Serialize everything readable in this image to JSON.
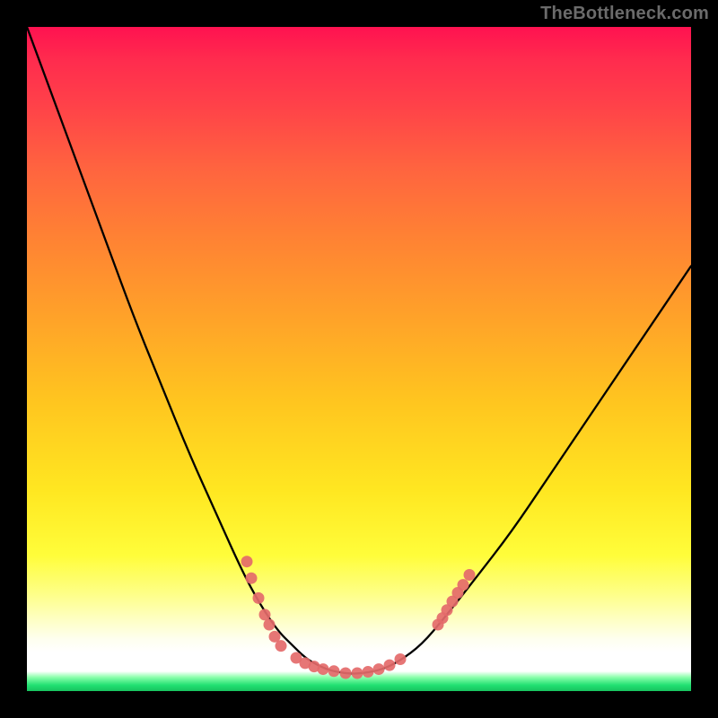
{
  "attribution": "TheBottleneck.com",
  "chart_data": {
    "type": "line",
    "title": "",
    "xlabel": "",
    "ylabel": "",
    "xlim": [
      0,
      740
    ],
    "ylim_percent": [
      0,
      100
    ],
    "series": [
      {
        "name": "bottleneck-curve",
        "x": [
          0,
          30,
          60,
          90,
          120,
          150,
          180,
          210,
          240,
          260,
          280,
          295,
          310,
          325,
          340,
          360,
          375,
          395,
          415,
          440,
          465,
          500,
          540,
          580,
          620,
          660,
          700,
          720,
          740
        ],
        "y": [
          100,
          89,
          78,
          67,
          56,
          46,
          36,
          27,
          18,
          13,
          9,
          7,
          5,
          3.8,
          3,
          2.6,
          2.7,
          3.2,
          4.5,
          7,
          11,
          17,
          24,
          32,
          40,
          48,
          56,
          60,
          64
        ]
      }
    ],
    "markers": [
      {
        "name": "cluster-left",
        "points": [
          {
            "x": 245,
            "y": 19.5
          },
          {
            "x": 250,
            "y": 17
          },
          {
            "x": 258,
            "y": 14
          },
          {
            "x": 265,
            "y": 11.5
          },
          {
            "x": 270,
            "y": 10
          },
          {
            "x": 276,
            "y": 8.2
          },
          {
            "x": 283,
            "y": 6.8
          }
        ]
      },
      {
        "name": "cluster-bottom",
        "points": [
          {
            "x": 300,
            "y": 5
          },
          {
            "x": 310,
            "y": 4.2
          },
          {
            "x": 320,
            "y": 3.7
          },
          {
            "x": 330,
            "y": 3.3
          },
          {
            "x": 342,
            "y": 3
          },
          {
            "x": 355,
            "y": 2.7
          },
          {
            "x": 368,
            "y": 2.7
          },
          {
            "x": 380,
            "y": 2.9
          },
          {
            "x": 392,
            "y": 3.3
          },
          {
            "x": 404,
            "y": 3.9
          },
          {
            "x": 416,
            "y": 4.8
          }
        ]
      },
      {
        "name": "cluster-right",
        "points": [
          {
            "x": 458,
            "y": 10
          },
          {
            "x": 463,
            "y": 11
          },
          {
            "x": 468,
            "y": 12.2
          },
          {
            "x": 474,
            "y": 13.5
          },
          {
            "x": 480,
            "y": 14.8
          },
          {
            "x": 486,
            "y": 16
          },
          {
            "x": 493,
            "y": 17.5
          }
        ]
      }
    ],
    "gradient_stops": [
      {
        "pos": 0,
        "color": "#ff1250"
      },
      {
        "pos": 5,
        "color": "#ff2b4e"
      },
      {
        "pos": 12,
        "color": "#ff4149"
      },
      {
        "pos": 22,
        "color": "#ff643f"
      },
      {
        "pos": 32,
        "color": "#ff8034"
      },
      {
        "pos": 45,
        "color": "#ffa229"
      },
      {
        "pos": 58,
        "color": "#ffc51f"
      },
      {
        "pos": 72,
        "color": "#ffe721"
      },
      {
        "pos": 82,
        "color": "#fffd3a"
      },
      {
        "pos": 88,
        "color": "#feff88"
      },
      {
        "pos": 92,
        "color": "#feffc4"
      },
      {
        "pos": 95,
        "color": "#feffef"
      },
      {
        "pos": 97,
        "color": "#ffffff"
      },
      {
        "pos": 98,
        "color": "#8bffab"
      },
      {
        "pos": 99,
        "color": "#21e072"
      },
      {
        "pos": 100,
        "color": "#18c45f"
      }
    ],
    "marker_color": "#e46a6a",
    "curve_color": "#000000"
  }
}
